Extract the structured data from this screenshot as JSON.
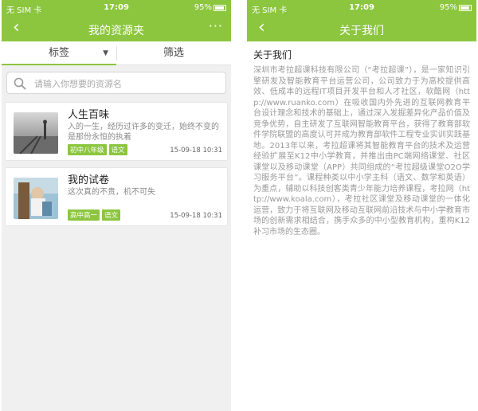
{
  "status": {
    "carrier": "无 SIM 卡",
    "time": "17:09",
    "battery": "95%"
  },
  "left": {
    "title": "我的资源夹",
    "back_icon": "back-arrow-icon",
    "more_icon": "more-icon",
    "tabs": [
      {
        "label": "标签"
      },
      {
        "label": "筛选"
      }
    ],
    "search": {
      "placeholder": "请输入你想要的资源名"
    },
    "cards": [
      {
        "title": "人生百味",
        "desc": "入的一生，经历过许多的变迁，始终不变的是那份永恒的执着",
        "tags": [
          "初中八年级",
          "语文"
        ],
        "time": "15-09-18 10:31"
      },
      {
        "title": "我的试卷",
        "desc": "这次真的不贵，机不可失",
        "tags": [
          "高中高一",
          "语文"
        ],
        "time": "15-09-18 10:31"
      }
    ]
  },
  "right": {
    "title": "关于我们",
    "back_icon": "back-arrow-icon",
    "heading": "关于我们",
    "body": "深圳市考拉超课科技有限公司（“考拉超课”），是一家知识引擎研发及智能教育平台运营公司，公司致力于为高校提供高效、低成本的远程IT项目开发平台和人才社区，软酷网（http://www.ruanko.com）在吸收国内外先进的互联网教育平台设计理念和技术的基础上，通过深入发掘差异化产品价值及竞争优势，自主研发了互联网智能教育平台，获得了教育部软件学院联盟的高度认可并成为教育部软件工程专业实训实践基地。2013年以来，考拉超课将其智能教育平台的技术及运营经验扩展至K12中小学教育，并推出由PC端网络课堂、社区课堂以及移动课堂（APP）共同组成的“考拉超级课堂O2O学习服务平台”。课程种类以中小学主科（语文、数学和英语）为重点，辅助以科技创客类青少年能力培养课程，考拉网（http://www.koala.com），考拉社区课堂及移动课堂的一体化运营，致力于将互联网及移动互联网前沿技术与中小学教育市场的创新需求相结合，携手众多的中小型教育机构，重构K12补习市场的生态圈。"
  },
  "colors": {
    "accent": "#8cc63f",
    "background": "#f0f0f0"
  }
}
